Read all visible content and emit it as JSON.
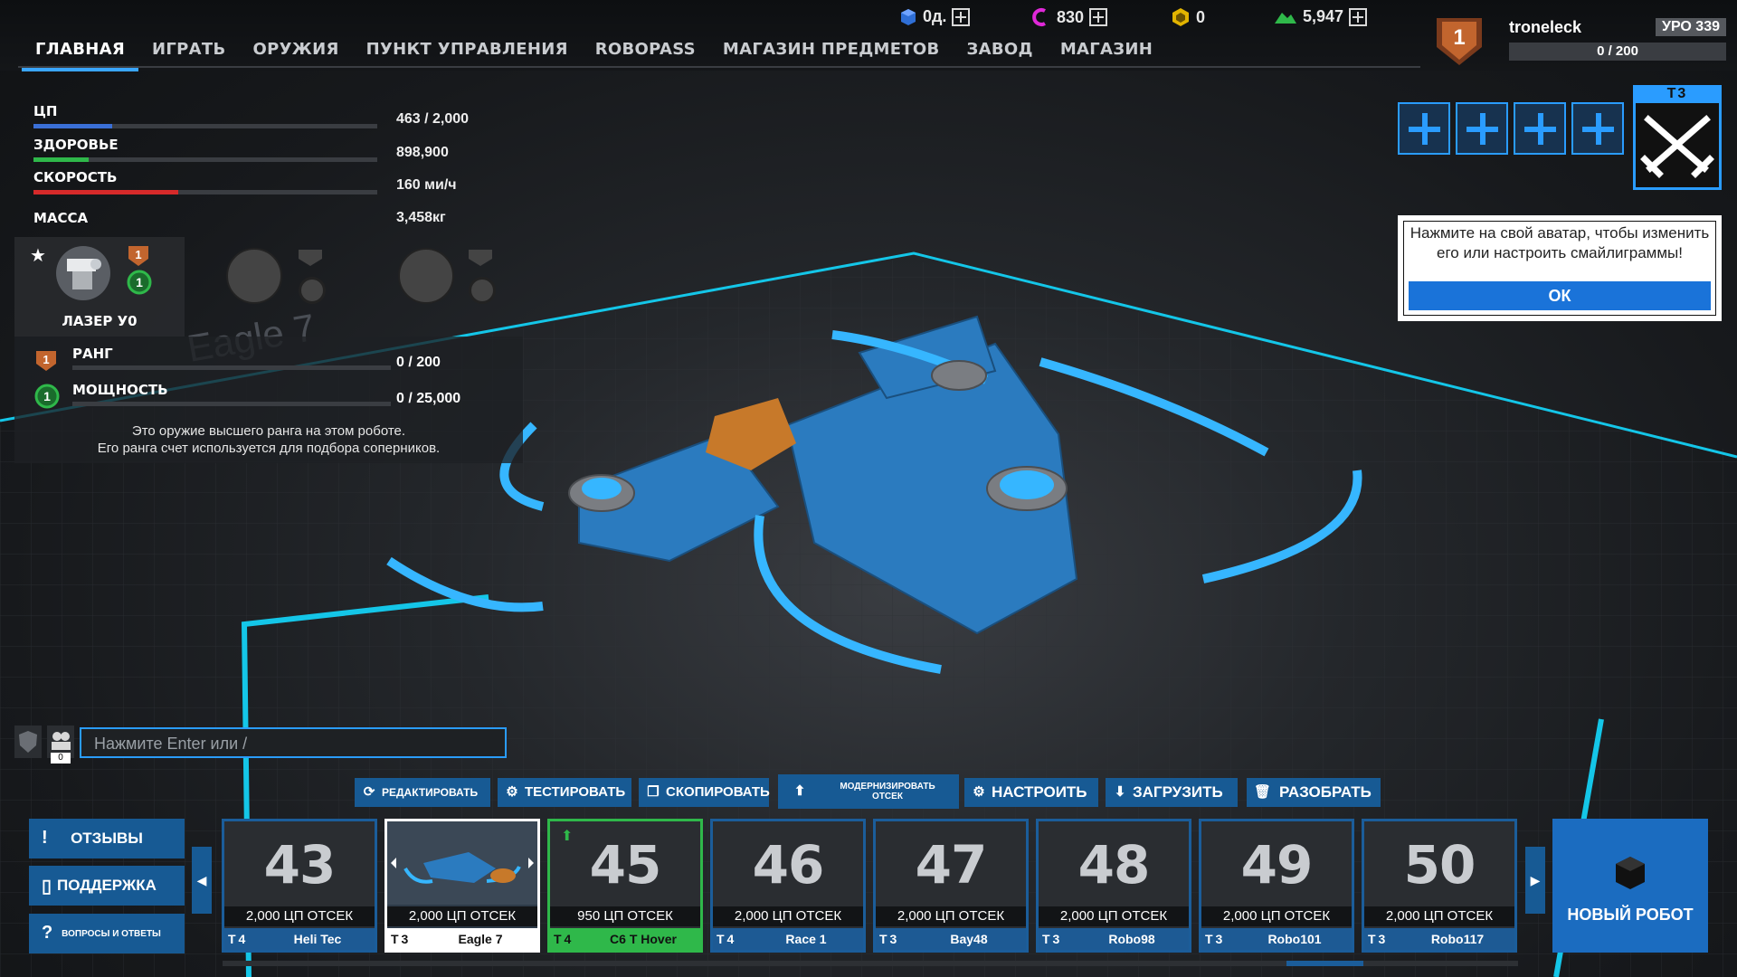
{
  "nav": {
    "tabs": [
      "ГЛАВНАЯ",
      "ИГРАТЬ",
      "ОРУЖИЯ",
      "ПУНКТ УПРАВЛЕНИЯ",
      "ROBOPASS",
      "МАГАЗИН ПРЕДМЕТОВ",
      "ЗАВОД",
      "МАГАЗИН"
    ],
    "active": "ГЛАВНАЯ"
  },
  "currencies": {
    "points": "0д.",
    "cosmetic": "830",
    "tech": "0",
    "robits": "5,947"
  },
  "player": {
    "name": "troneleck",
    "tier_label": "УРО 339",
    "rank": "1",
    "xp": "0 / 200"
  },
  "loadout": {
    "tier_label": "Т3",
    "slot_icon": "plus-icon",
    "active_icon": "crossed-swords-icon"
  },
  "tooltip": {
    "text": "Нажмите на свой аватар, чтобы изменить его или настроить смайлиграммы!",
    "ok": "ОК"
  },
  "stats": {
    "cpu": {
      "label": "ЦП",
      "value": "463 / 2,000",
      "fill": 0.23,
      "color": "#3a6fd6"
    },
    "health": {
      "label": "ЗДОРОВЬЕ",
      "value": "898,900",
      "fill": 0.16,
      "color": "#2fb84a"
    },
    "speed": {
      "label": "СКОРОСТЬ",
      "value": "160 ми/ч",
      "fill": 0.42,
      "color": "#d62a2a"
    },
    "mass": {
      "label": "МАССА",
      "value": "3,458кг"
    }
  },
  "weapon": {
    "name": "ЛАЗЕР У0",
    "rank_badge": "1",
    "power_badge": "1"
  },
  "rank_panel": {
    "rank_label": "РАНГ",
    "rank_value": "0 / 200",
    "rank_badge": "1",
    "power_label": "МОЩНОСТЬ",
    "power_value": "0 / 25,000",
    "power_badge": "1",
    "note_line1": "Это оружие высшего ранга на этом роботе.",
    "note_line2": "Его ранга счет используется для подбора соперников."
  },
  "chat": {
    "placeholder": "Нажмите Enter или /",
    "count": "0"
  },
  "actions": [
    "РЕДАКТИРОВАТЬ",
    "ТЕСТИРОВАТЬ",
    "СКОПИРОВАТЬ",
    "МОДЕРНИЗИРОВАТЬ ОТСЕК",
    "НАСТРОИТЬ",
    "ЗАГРУЗИТЬ",
    "РАЗОБРАТЬ"
  ],
  "side": {
    "feedback": "ОТЗЫВЫ",
    "support": "ПОДДЕРЖКА",
    "faq": "ВОПРОСЫ И ОТВЕТЫ"
  },
  "robots": [
    {
      "num": "43",
      "cpu": "2,000 ЦП ОТСЕК",
      "tier": "Т4",
      "name": "Heli Tec"
    },
    {
      "num": "",
      "cpu": "2,000 ЦП ОТСЕК",
      "tier": "Т3",
      "name": "Eagle 7"
    },
    {
      "num": "45",
      "cpu": "950 ЦП ОТСЕК",
      "tier": "Т4",
      "name": "C6 T Hover"
    },
    {
      "num": "46",
      "cpu": "2,000 ЦП ОТСЕК",
      "tier": "Т4",
      "name": "Race 1"
    },
    {
      "num": "47",
      "cpu": "2,000 ЦП ОТСЕК",
      "tier": "Т3",
      "name": "Bay48"
    },
    {
      "num": "48",
      "cpu": "2,000 ЦП ОТСЕК",
      "tier": "Т3",
      "name": "Robo98"
    },
    {
      "num": "49",
      "cpu": "2,000 ЦП ОТСЕК",
      "tier": "Т3",
      "name": "Robo101"
    },
    {
      "num": "50",
      "cpu": "2,000 ЦП ОТСЕК",
      "tier": "Т3",
      "name": "Robo117"
    }
  ],
  "new_robot": "НОВЫЙ РОБОТ",
  "backdrop_text": "Eagle 7"
}
